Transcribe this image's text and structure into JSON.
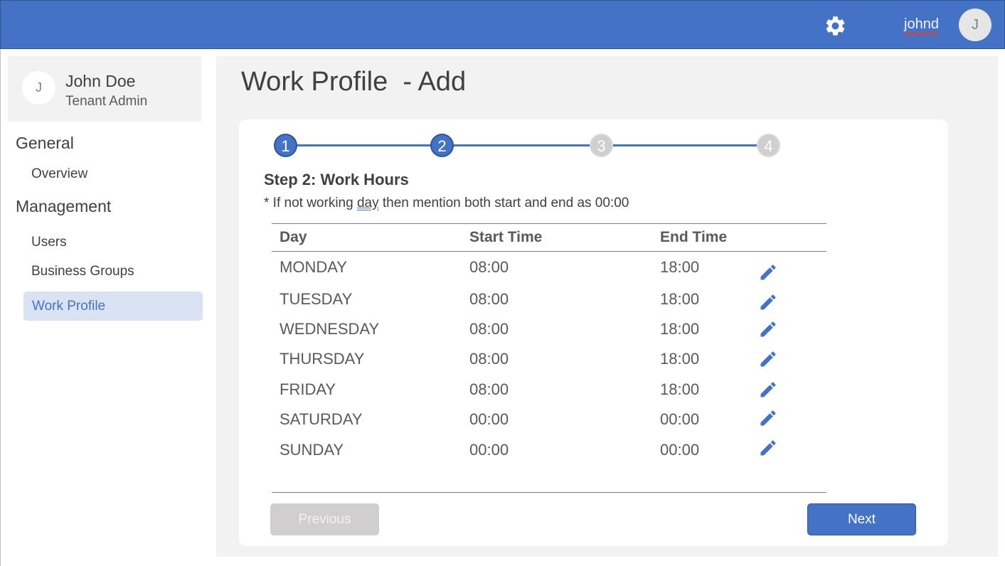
{
  "header": {
    "username": "johnd",
    "avatar_initial": "J",
    "settings_icon": "gear-icon"
  },
  "profile": {
    "avatar_initial": "J",
    "name": "John Doe",
    "role": "Tenant Admin"
  },
  "sidebar": {
    "general_label": "General",
    "general_items": [
      {
        "label": "Overview"
      }
    ],
    "management_label": "Management",
    "management_items": [
      {
        "label": "Users"
      },
      {
        "label": "Business Groups"
      },
      {
        "label": "Work Profile",
        "active": true
      }
    ]
  },
  "page": {
    "title": "Work Profile  - Add"
  },
  "stepper": {
    "current_step": 2,
    "steps": [
      {
        "number": "1",
        "state": "done"
      },
      {
        "number": "2",
        "state": "done"
      },
      {
        "number": "3",
        "state": "todo"
      },
      {
        "number": "4",
        "state": "todo"
      }
    ]
  },
  "form": {
    "step_title": "Step 2: Work Hours",
    "note_before": "* If not working ",
    "note_underlined": "day",
    "note_after": " then mention both start and end as 00:00"
  },
  "table": {
    "headers": [
      "Day",
      "Start Time",
      "End Time"
    ],
    "edit_icon": "pencil-icon",
    "rows": [
      {
        "day": "MONDAY",
        "start": "08:00",
        "end": "18:00"
      },
      {
        "day": "TUESDAY",
        "start": "08:00",
        "end": "18:00"
      },
      {
        "day": "WEDNESDAY",
        "start": "08:00",
        "end": "18:00"
      },
      {
        "day": "THURSDAY",
        "start": "08:00",
        "end": "18:00"
      },
      {
        "day": "FRIDAY",
        "start": "08:00",
        "end": "18:00"
      },
      {
        "day": "SATURDAY",
        "start": "00:00",
        "end": "00:00"
      },
      {
        "day": "SUNDAY",
        "start": "00:00",
        "end": "00:00"
      }
    ]
  },
  "buttons": {
    "previous": "Previous",
    "previous_disabled": true,
    "next": "Next"
  },
  "colors": {
    "brand_blue": "#4472c4",
    "active_nav_bg": "#dae3f3",
    "panel_gray": "#f2f2f2",
    "disabled_gray": "#d0cece"
  }
}
